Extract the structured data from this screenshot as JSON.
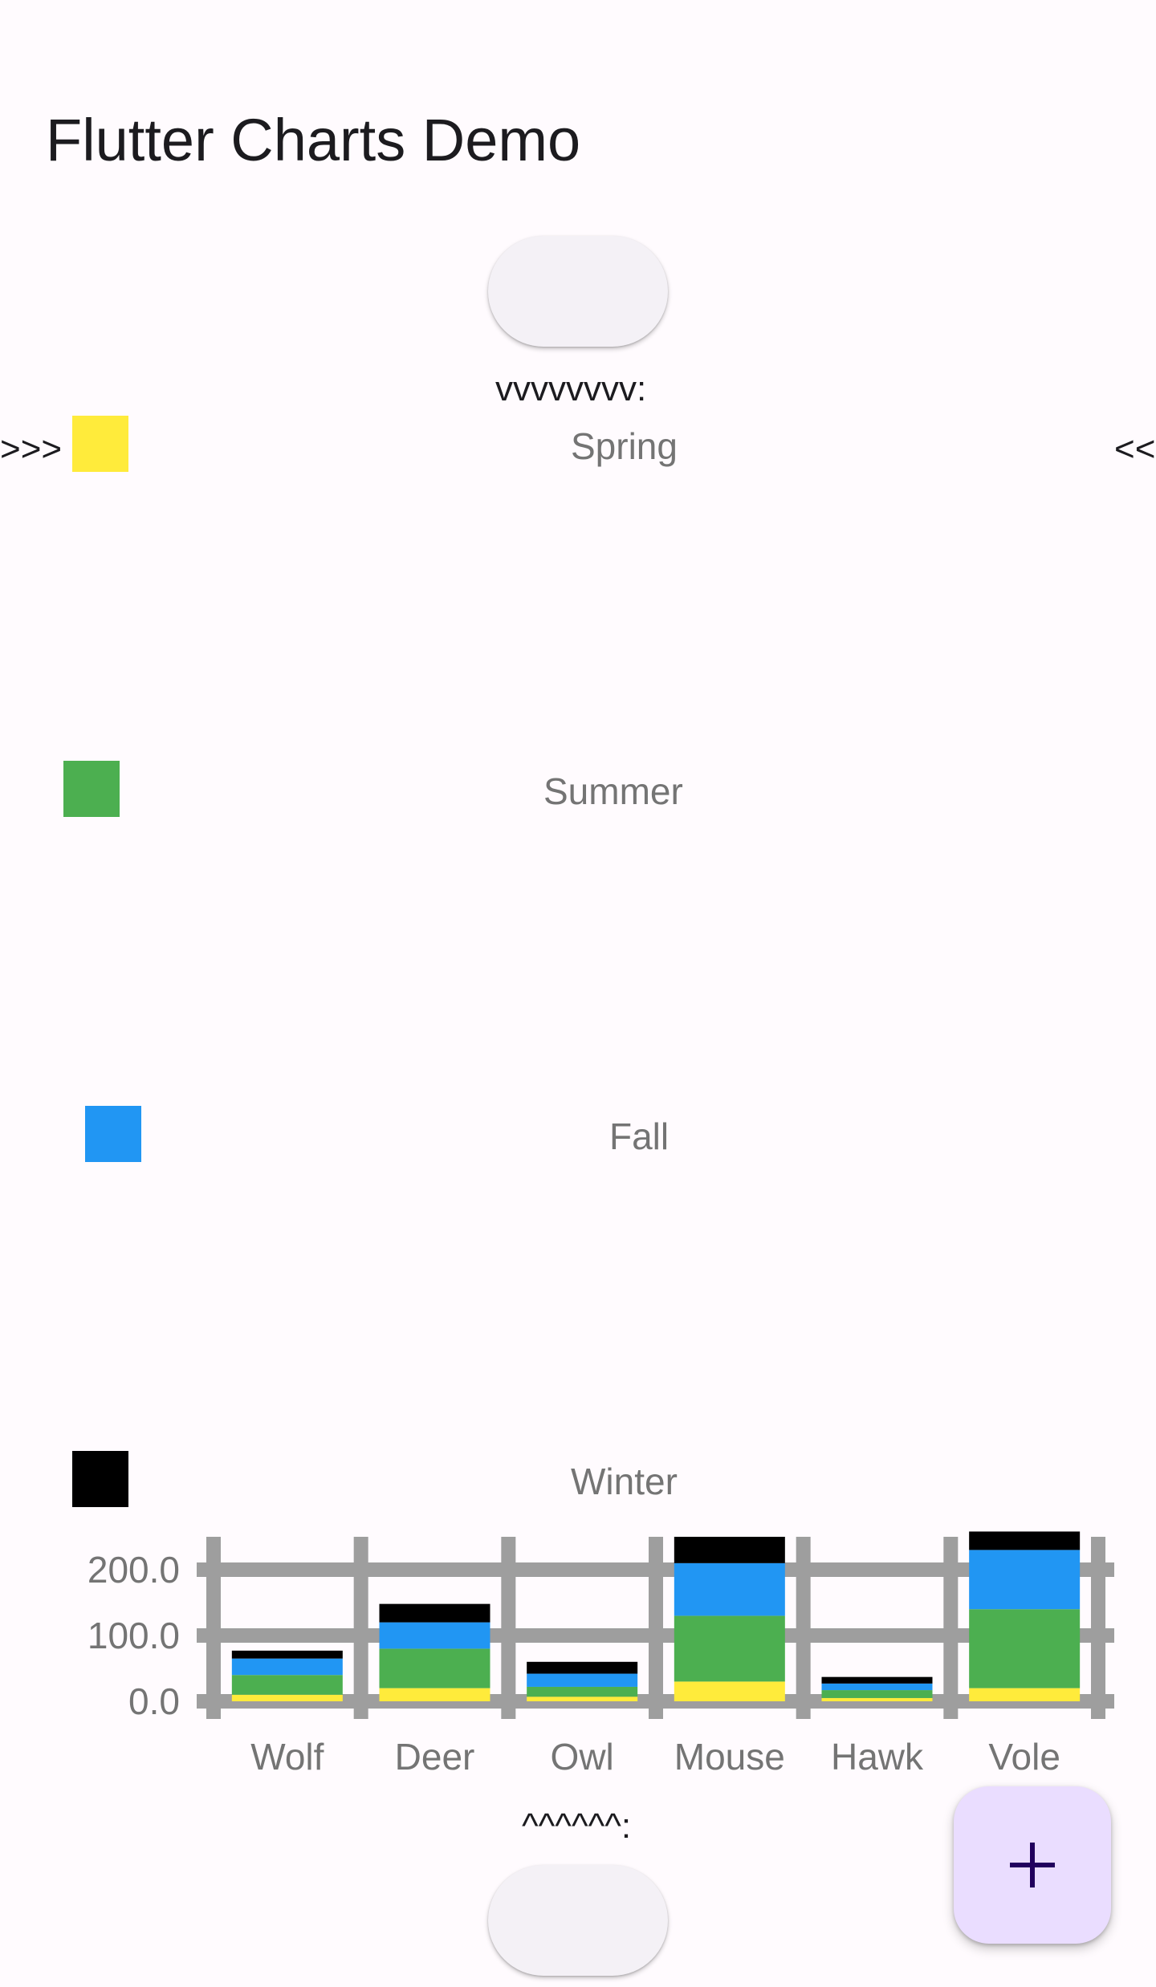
{
  "app": {
    "title": "Flutter Charts Demo"
  },
  "markers": {
    "top": "vvvvvvvv:",
    "left": ">>>",
    "right": "<<",
    "bottom": "^^^^^^:"
  },
  "colors": {
    "spring": "#ffeb3b",
    "summer": "#4caf50",
    "fall": "#2196f3",
    "winter": "#000000",
    "grid": "#9e9e9e",
    "fab_background": "#eaddff",
    "fab_icon": "#21005d"
  },
  "fab": {
    "icon": "plus-icon"
  },
  "chart_data": {
    "type": "bar",
    "stacked": true,
    "categories": [
      "Wolf",
      "Deer",
      "Owl",
      "Mouse",
      "Hawk",
      "Vole"
    ],
    "series": [
      {
        "name": "Spring",
        "color": "#ffeb3b",
        "values": [
          10,
          20,
          7,
          30,
          5,
          20
        ]
      },
      {
        "name": "Summer",
        "color": "#4caf50",
        "values": [
          30,
          60,
          15,
          100,
          12,
          120
        ]
      },
      {
        "name": "Fall",
        "color": "#2196f3",
        "values": [
          25,
          40,
          20,
          80,
          10,
          90
        ]
      },
      {
        "name": "Winter",
        "color": "#000000",
        "values": [
          12,
          28,
          18,
          40,
          10,
          28
        ]
      }
    ],
    "y_ticks": [
      "0.0",
      "100.0",
      "200.0"
    ],
    "ylim": [
      0,
      250
    ],
    "grid": true,
    "legend_position": "top"
  }
}
